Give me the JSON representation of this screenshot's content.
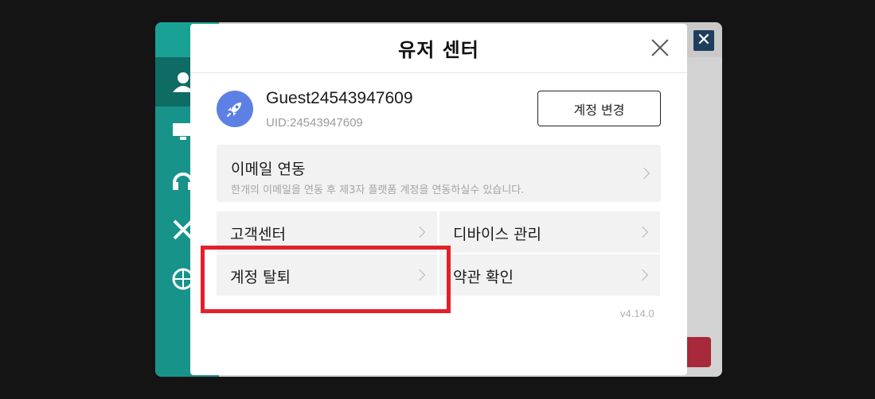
{
  "background": {
    "sidebar_icons": [
      "user-icon",
      "monitor-icon",
      "headset-icon",
      "swords-icon",
      "globe-icon"
    ],
    "close_glyph": "✕",
    "accent_color": "#17938a"
  },
  "modal": {
    "title": "유저 센터",
    "profile": {
      "username": "Guest24543947609",
      "uid": "UID:24543947609",
      "change_account_label": "계정 변경"
    },
    "email_link": {
      "title": "이메일 연동",
      "description": "한개의 이메일을 연동 후 제3자 플랫폼 계정을 연동하실수 있습니다."
    },
    "menu": [
      {
        "label": "고객센터"
      },
      {
        "label": "디바이스 관리"
      },
      {
        "label": "계정 탈퇴"
      },
      {
        "label": "약관 확인"
      }
    ],
    "version": "v4.14.0"
  },
  "highlight_color": "#e3202a"
}
